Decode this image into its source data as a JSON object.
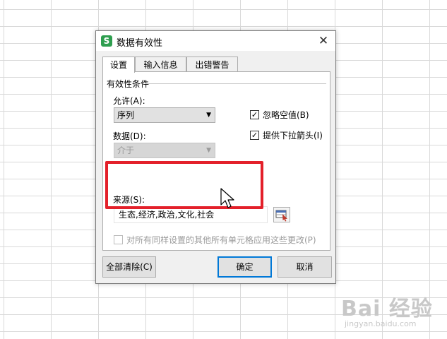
{
  "dialog": {
    "title": "数据有效性",
    "app_icon_letter": "S",
    "close_glyph": "✕"
  },
  "tabs": [
    {
      "label": "设置",
      "active": true
    },
    {
      "label": "输入信息",
      "active": false
    },
    {
      "label": "出错警告",
      "active": false
    }
  ],
  "settings": {
    "group_label": "有效性条件",
    "allow_label": "允许(A):",
    "allow_value": "序列",
    "data_label": "数据(D):",
    "data_value": "介于",
    "ignore_blank": {
      "label": "忽略空值(B)",
      "checked": true
    },
    "dropdown_arrow": {
      "label": "提供下拉箭头(I)",
      "checked": true
    },
    "source_label": "来源(S):",
    "source_value": "生态,经济,政治,文化,社会",
    "apply_all": {
      "label": "对所有同样设置的其他所有单元格应用这些更改(P)",
      "checked": false
    }
  },
  "buttons": {
    "clear_all": "全部清除(C)",
    "ok": "确定",
    "cancel": "取消"
  },
  "colors": {
    "highlight": "#e3202a",
    "app_icon": "#2e9e4f",
    "primary_border": "#0078d7"
  },
  "watermark": {
    "text": "Bai 经验",
    "url": "jingyan.baidu.com"
  }
}
